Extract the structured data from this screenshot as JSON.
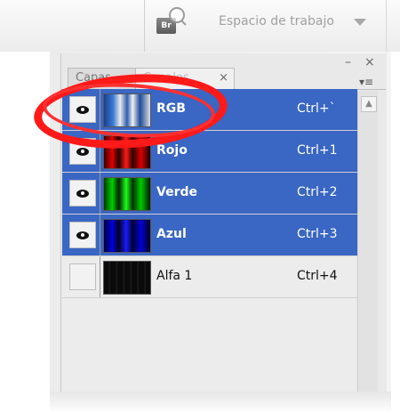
{
  "topbar": {
    "bridge_icon_label": "Br",
    "workspace_label": "Espacio de trabajo"
  },
  "window_controls": {
    "minimize": "–",
    "close": "×"
  },
  "tabs": [
    {
      "label": "Capas"
    },
    {
      "label": "Canales",
      "close": "×"
    }
  ],
  "panel_menu_icon": "panel-menu-icon",
  "channels": [
    {
      "name": "RGB",
      "shortcut": "Ctrl+`",
      "visible": true,
      "selected": true,
      "thumb": "multicolor"
    },
    {
      "name": "Rojo",
      "shortcut": "Ctrl+1",
      "visible": true,
      "selected": true,
      "thumb": "red"
    },
    {
      "name": "Verde",
      "shortcut": "Ctrl+2",
      "visible": true,
      "selected": true,
      "thumb": "green"
    },
    {
      "name": "Azul",
      "shortcut": "Ctrl+3",
      "visible": true,
      "selected": true,
      "thumb": "blue"
    },
    {
      "name": "Alfa 1",
      "shortcut": "Ctrl+4",
      "visible": false,
      "selected": false,
      "thumb": "black"
    }
  ],
  "colors": {
    "selection": "#3a66c4",
    "highlight_circle": "#ff1a1a"
  }
}
